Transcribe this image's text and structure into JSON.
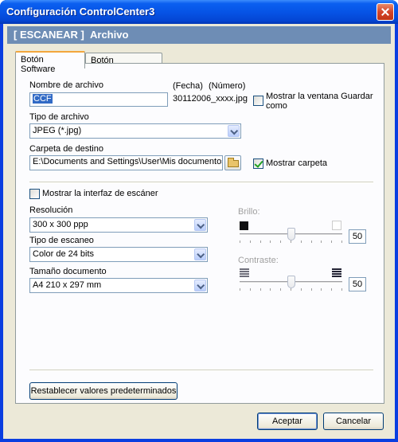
{
  "window": {
    "title": "Configuración ControlCenter3"
  },
  "header": {
    "section": "[  ESCANEAR  ]",
    "page": "Archivo"
  },
  "tabs": [
    {
      "label": "Botón Software",
      "active": true
    },
    {
      "label": "Botón Dispositivo",
      "active": false
    }
  ],
  "file": {
    "name_label": "Nombre de archivo",
    "name_value": "CCF",
    "date_label": "(Fecha)",
    "number_label": "(Número)",
    "pattern": "30112006_xxxx.jpg",
    "show_save_window_label": "Mostrar la ventana Guardar como",
    "show_save_window_checked": false
  },
  "file_type": {
    "label": "Tipo de archivo",
    "selected": "JPEG (*.jpg)"
  },
  "destination": {
    "label": "Carpeta de destino",
    "value": "E:\\Documents and Settings\\User\\Mis documentos\\Mi",
    "show_folder_label": "Mostrar carpeta",
    "show_folder_checked": true
  },
  "scanner": {
    "show_interface_label": "Mostrar la interfaz de escáner",
    "show_interface_checked": false
  },
  "resolution": {
    "label": "Resolución",
    "selected": "300 x 300 ppp"
  },
  "scan_type": {
    "label": "Tipo de escaneo",
    "selected": "Color de 24 bits"
  },
  "document_size": {
    "label": "Tamaño documento",
    "selected": "A4 210 x 297 mm"
  },
  "brightness": {
    "label": "Brillo:",
    "value": "50",
    "level": 0.5,
    "enabled": false
  },
  "contrast": {
    "label": "Contraste:",
    "value": "50",
    "level": 0.5,
    "enabled": false
  },
  "buttons": {
    "reset": "Restablecer valores predeterminados",
    "accept": "Aceptar",
    "cancel": "Cancelar"
  },
  "colors": {
    "title_bar": "#0654e6",
    "header_bar": "#6e8db5",
    "window_bg": "#ece9d8",
    "tab_accent": "#f3a73c"
  }
}
